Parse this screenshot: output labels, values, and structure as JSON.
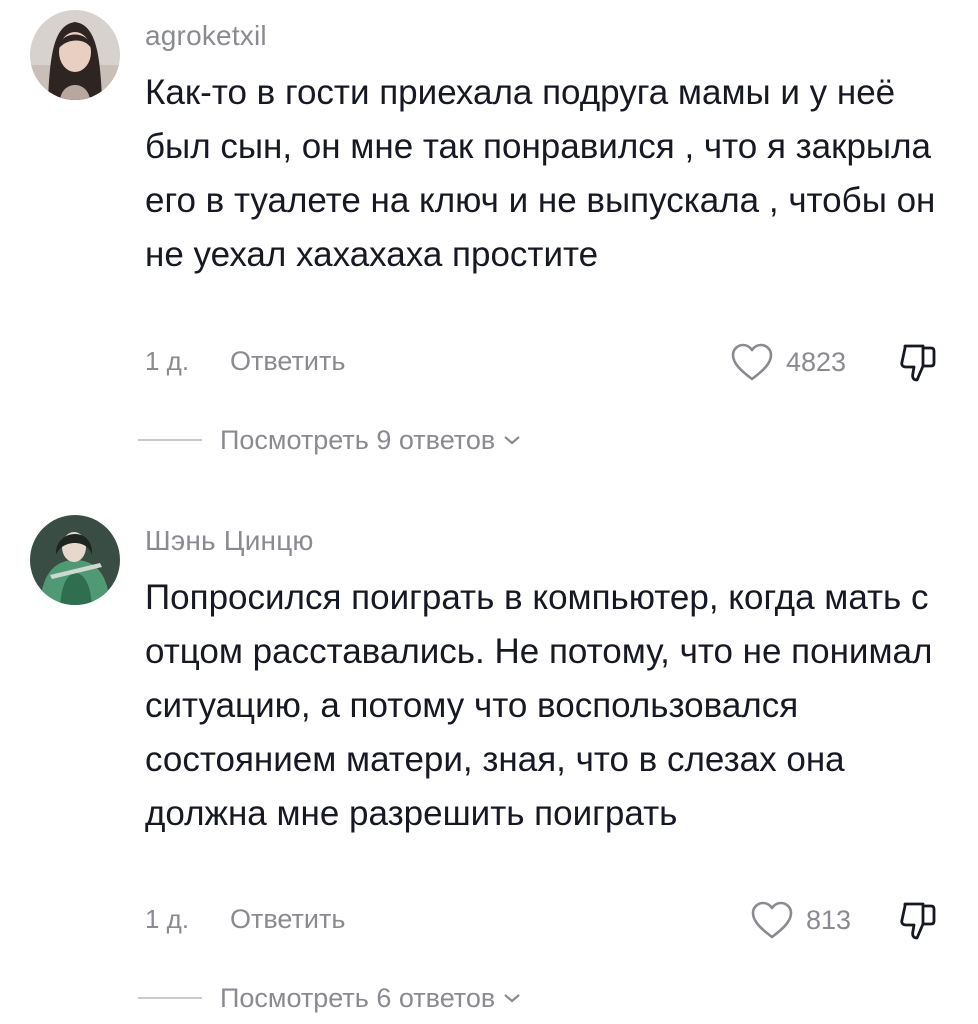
{
  "comments": [
    {
      "username": "agroketxil",
      "text": "Как-то в гости приехала подруга мамы и у неё был сын, он мне так понравился , что я закрыла его в туалете на ключ и не выпускала , чтобы он не уехал хахахаха простите",
      "time": "1 д.",
      "reply_label": "Ответить",
      "likes": "4823",
      "view_replies": "Посмотреть 9 ответов"
    },
    {
      "username": "Шэнь Цинцю",
      "text": "Попросился поиграть в компьютер, когда мать с отцом расставались. Не потому, что не понимал ситуацию, а потому что воспользовался состоянием матери, зная, что в слезах она должна мне разрешить поиграть",
      "time": "1 д.",
      "reply_label": "Ответить",
      "likes": "813",
      "view_replies": "Посмотреть 6 ответов"
    }
  ],
  "icons": {
    "like": "heart-outline-icon",
    "dislike": "thumbs-down-outline-icon",
    "expand": "chevron-down-icon"
  },
  "colors": {
    "text": "#161823",
    "secondary": "#8a8b91",
    "divider": "#c9cacd"
  }
}
